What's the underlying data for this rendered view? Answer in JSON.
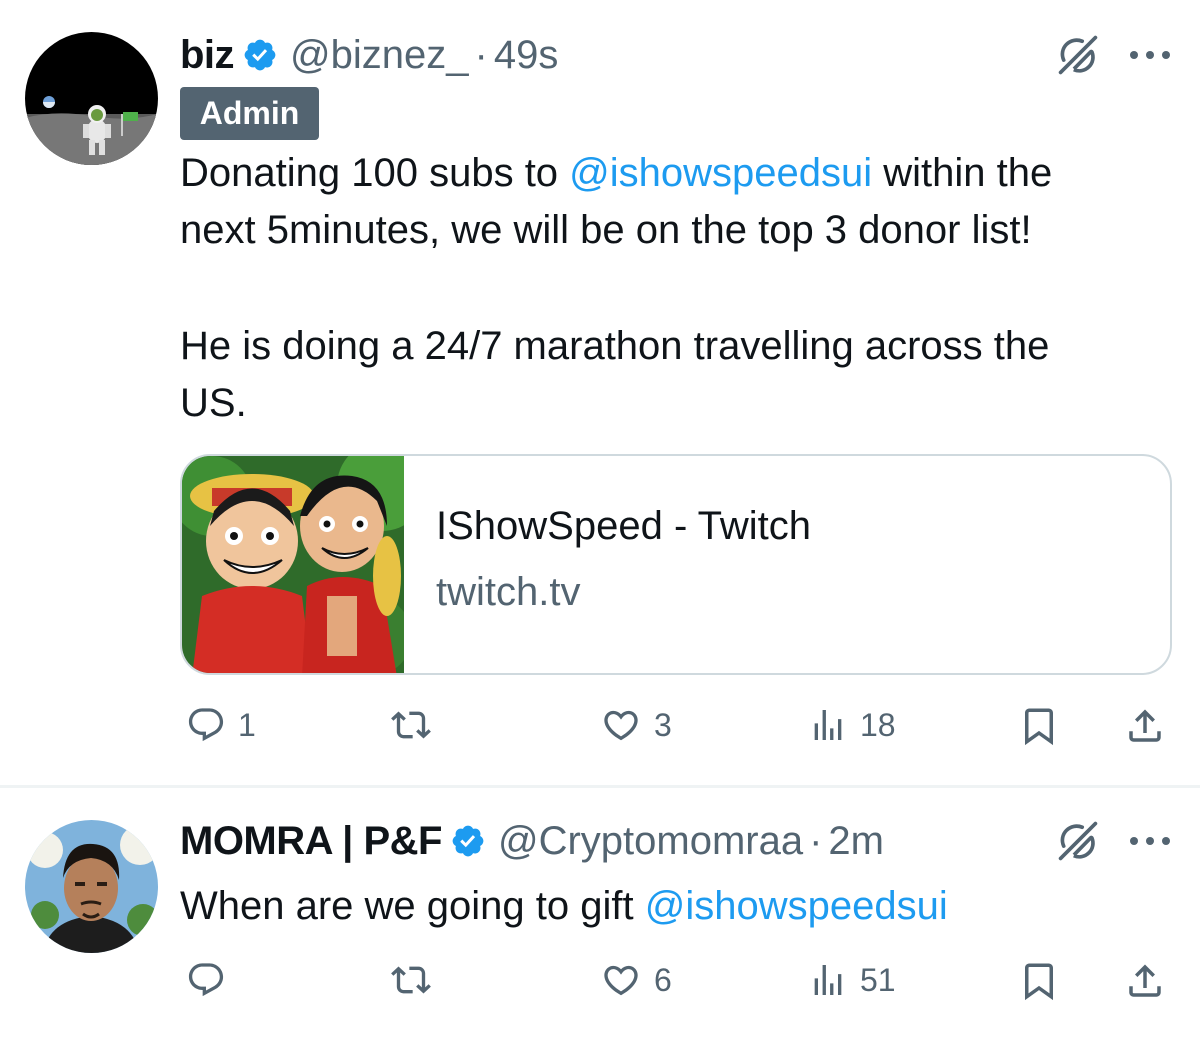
{
  "tweets": [
    {
      "author_name": "biz",
      "handle": "@biznez_",
      "separator": "·",
      "time": "49s",
      "badge": "Admin",
      "text_line1_a": "Donating 100 subs to ",
      "text_line1_mention": "@ishowspeedsui",
      "text_line1_b": " within the",
      "text_line2": "next 5minutes, we will be on the top 3 donor list!",
      "text_line3": "He is doing a 24/7 marathon travelling across the",
      "text_line4": "US.",
      "card": {
        "title": "IShowSpeed - Twitch",
        "domain": "twitch.tv"
      },
      "counts": {
        "replies": "1",
        "reposts": "",
        "likes": "3",
        "views": "18"
      },
      "verified": true
    },
    {
      "author_name": "MOMRA | P&F",
      "handle": "@Cryptomomraa",
      "separator": "·",
      "time": "2m",
      "text_a": "When are we going to gift ",
      "text_mention": "@ishowspeedsui",
      "counts": {
        "replies": "",
        "reposts": "",
        "likes": "6",
        "views": "51"
      },
      "verified": true
    }
  ],
  "colors": {
    "mention": "#1d9bf0",
    "secondary_text": "#536471",
    "badge_bg": "#536471",
    "verified": "#1d9bf0"
  },
  "icons": [
    "grok-icon",
    "more-icon",
    "reply-icon",
    "repost-icon",
    "like-icon",
    "views-icon",
    "bookmark-icon",
    "share-icon",
    "verified-icon"
  ]
}
